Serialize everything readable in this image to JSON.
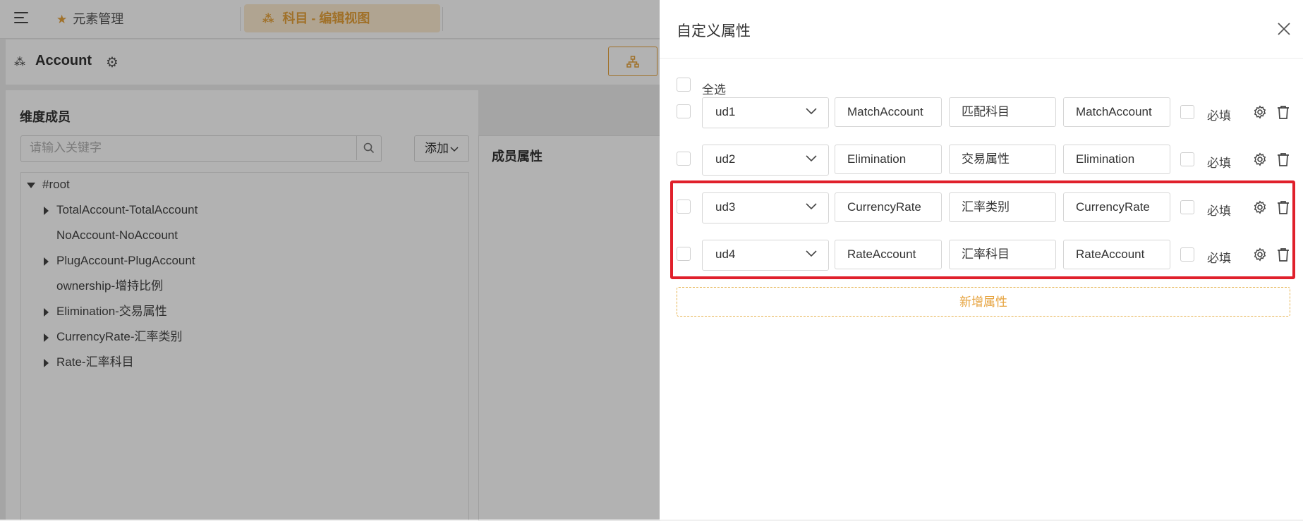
{
  "tabs": [
    {
      "label": "元素管理",
      "icon": "star-icon"
    },
    {
      "label": "科目 - 编辑视图",
      "icon": "hierarchy-icon",
      "active": true
    }
  ],
  "header": {
    "title": "Account"
  },
  "left_panel": {
    "title": "维度成员",
    "search_placeholder": "请输入关键字",
    "add_label": "添加",
    "tree": [
      {
        "label": "#root",
        "expanded": true
      },
      {
        "label": "TotalAccount-TotalAccount",
        "has_children": true
      },
      {
        "label": "NoAccount-NoAccount",
        "has_children": false
      },
      {
        "label": "PlugAccount-PlugAccount",
        "has_children": true
      },
      {
        "label": "ownership-增持比例",
        "has_children": false
      },
      {
        "label": "Elimination-交易属性",
        "has_children": true
      },
      {
        "label": "CurrencyRate-汇率类别",
        "has_children": true
      },
      {
        "label": "Rate-汇率科目",
        "has_children": true
      }
    ]
  },
  "middle_panel": {
    "title": "成员属性"
  },
  "drawer": {
    "title": "自定义属性",
    "select_all_label": "全选",
    "required_label": "必填",
    "add_attribute_label": "新增属性",
    "rows": [
      {
        "type": "ud1",
        "name": "MatchAccount",
        "desc": "匹配科目",
        "code": "MatchAccount"
      },
      {
        "type": "ud2",
        "name": "Elimination",
        "desc": "交易属性",
        "code": "Elimination"
      },
      {
        "type": "ud3",
        "name": "CurrencyRate",
        "desc": "汇率类别",
        "code": "CurrencyRate"
      },
      {
        "type": "ud4",
        "name": "RateAccount",
        "desc": "汇率科目",
        "code": "RateAccount"
      }
    ]
  },
  "colors": {
    "accent": "#e6a23c",
    "highlight": "#e0202b"
  }
}
